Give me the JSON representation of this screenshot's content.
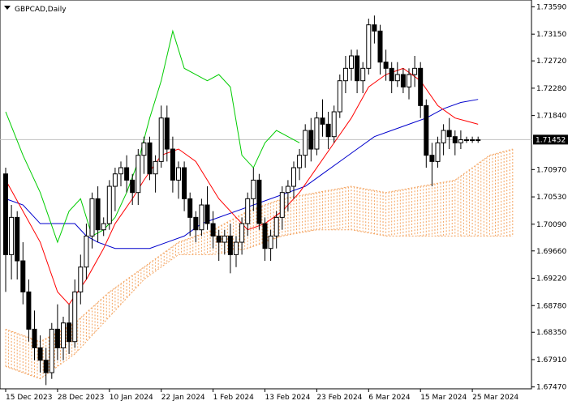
{
  "chart_data": {
    "type": "candlestick",
    "title": "GBPCAD,Daily",
    "y_range": [
      1.6744,
      1.737
    ],
    "y_ticks": [
      "1.73590",
      "1.73150",
      "1.72720",
      "1.72280",
      "1.71840",
      "1.71452",
      "1.70970",
      "1.70530",
      "1.70090",
      "1.69660",
      "1.69220",
      "1.68780",
      "1.68350",
      "1.67910",
      "1.67470"
    ],
    "x_labels": [
      {
        "label": "15 Dec 2023",
        "index": 0
      },
      {
        "label": "28 Dec 2023",
        "index": 9
      },
      {
        "label": "10 Jan 2024",
        "index": 18
      },
      {
        "label": "22 Jan 2024",
        "index": 27
      },
      {
        "label": "1 Feb 2024",
        "index": 36
      },
      {
        "label": "13 Feb 2024",
        "index": 45
      },
      {
        "label": "23 Feb 2024",
        "index": 54
      },
      {
        "label": "6 Mar 2024",
        "index": 63
      },
      {
        "label": "15 Mar 2024",
        "index": 72
      },
      {
        "label": "25 Mar 2024",
        "index": 81
      }
    ],
    "current_price": 1.71452,
    "colors": {
      "tenkan": "#ff0000",
      "kijun": "#0000cc",
      "chikou": "#00cc00",
      "cloud": "#f4a460",
      "candle": "#000000",
      "bullish_body": "#ffffff",
      "bearish_body": "#000000",
      "price_tag_bg": "#000000",
      "current_line": "#c0c0c0"
    },
    "candles": [
      [
        1.709,
        1.71,
        1.69,
        1.696
      ],
      [
        1.696,
        1.704,
        1.692,
        1.702
      ],
      [
        1.702,
        1.703,
        1.692,
        1.695
      ],
      [
        1.695,
        1.698,
        1.688,
        1.69
      ],
      [
        1.69,
        1.692,
        1.682,
        1.684
      ],
      [
        1.684,
        1.687,
        1.679,
        1.681
      ],
      [
        1.681,
        1.683,
        1.677,
        1.679
      ],
      [
        1.679,
        1.681,
        1.675,
        1.677
      ],
      [
        1.677,
        1.685,
        1.676,
        1.684
      ],
      [
        1.684,
        1.688,
        1.679,
        1.681
      ],
      [
        1.681,
        1.686,
        1.679,
        1.685
      ],
      [
        1.685,
        1.688,
        1.68,
        1.682
      ],
      [
        1.682,
        1.692,
        1.681,
        1.69
      ],
      [
        1.69,
        1.696,
        1.688,
        1.694
      ],
      [
        1.694,
        1.701,
        1.692,
        1.699
      ],
      [
        1.699,
        1.706,
        1.697,
        1.705
      ],
      [
        1.705,
        1.707,
        1.698,
        1.7
      ],
      [
        1.7,
        1.702,
        1.699,
        1.701
      ],
      [
        1.701,
        1.708,
        1.7,
        1.707
      ],
      [
        1.707,
        1.71,
        1.703,
        1.709
      ],
      [
        1.709,
        1.711,
        1.707,
        1.71
      ],
      [
        1.71,
        1.712,
        1.706,
        1.708
      ],
      [
        1.708,
        1.709,
        1.704,
        1.706
      ],
      [
        1.706,
        1.713,
        1.704,
        1.712
      ],
      [
        1.712,
        1.715,
        1.709,
        1.714
      ],
      [
        1.714,
        1.715,
        1.708,
        1.709
      ],
      [
        1.709,
        1.712,
        1.706,
        1.711
      ],
      [
        1.711,
        1.72,
        1.71,
        1.718
      ],
      [
        1.718,
        1.72,
        1.711,
        1.713
      ],
      [
        1.713,
        1.715,
        1.706,
        1.708
      ],
      [
        1.708,
        1.711,
        1.705,
        1.71
      ],
      [
        1.71,
        1.711,
        1.703,
        1.705
      ],
      [
        1.705,
        1.706,
        1.699,
        1.702
      ],
      [
        1.702,
        1.703,
        1.698,
        1.7
      ],
      [
        1.7,
        1.705,
        1.699,
        1.704
      ],
      [
        1.704,
        1.707,
        1.7,
        1.701
      ],
      [
        1.701,
        1.703,
        1.697,
        1.699
      ],
      [
        1.699,
        1.7,
        1.695,
        1.698
      ],
      [
        1.698,
        1.7,
        1.696,
        1.699
      ],
      [
        1.699,
        1.701,
        1.693,
        1.696
      ],
      [
        1.696,
        1.699,
        1.694,
        1.698
      ],
      [
        1.698,
        1.702,
        1.696,
        1.701
      ],
      [
        1.701,
        1.706,
        1.699,
        1.705
      ],
      [
        1.705,
        1.71,
        1.703,
        1.708
      ],
      [
        1.708,
        1.709,
        1.7,
        1.701
      ],
      [
        1.701,
        1.702,
        1.695,
        1.697
      ],
      [
        1.697,
        1.7,
        1.695,
        1.699
      ],
      [
        1.699,
        1.703,
        1.697,
        1.702
      ],
      [
        1.702,
        1.707,
        1.7,
        1.706
      ],
      [
        1.706,
        1.708,
        1.703,
        1.707
      ],
      [
        1.707,
        1.711,
        1.705,
        1.71
      ],
      [
        1.71,
        1.713,
        1.708,
        1.712
      ],
      [
        1.712,
        1.717,
        1.71,
        1.716
      ],
      [
        1.716,
        1.718,
        1.711,
        1.713
      ],
      [
        1.713,
        1.719,
        1.712,
        1.718
      ],
      [
        1.718,
        1.721,
        1.715,
        1.717
      ],
      [
        1.717,
        1.719,
        1.713,
        1.715
      ],
      [
        1.715,
        1.72,
        1.714,
        1.719
      ],
      [
        1.719,
        1.725,
        1.718,
        1.724
      ],
      [
        1.724,
        1.728,
        1.722,
        1.726
      ],
      [
        1.726,
        1.729,
        1.724,
        1.728
      ],
      [
        1.728,
        1.729,
        1.722,
        1.724
      ],
      [
        1.724,
        1.727,
        1.722,
        1.726
      ],
      [
        1.726,
        1.734,
        1.725,
        1.733
      ],
      [
        1.733,
        1.7345,
        1.73,
        1.732
      ],
      [
        1.732,
        1.733,
        1.725,
        1.727
      ],
      [
        1.727,
        1.729,
        1.724,
        1.726
      ],
      [
        1.726,
        1.727,
        1.722,
        1.724
      ],
      [
        1.724,
        1.727,
        1.723,
        1.725
      ],
      [
        1.725,
        1.726,
        1.722,
        1.723
      ],
      [
        1.723,
        1.726,
        1.721,
        1.725
      ],
      [
        1.725,
        1.728,
        1.723,
        1.726
      ],
      [
        1.726,
        1.727,
        1.718,
        1.72
      ],
      [
        1.72,
        1.721,
        1.71,
        1.712
      ],
      [
        1.712,
        1.714,
        1.707,
        1.711
      ],
      [
        1.711,
        1.715,
        1.71,
        1.714
      ],
      [
        1.714,
        1.717,
        1.712,
        1.716
      ],
      [
        1.716,
        1.718,
        1.713,
        1.715
      ],
      [
        1.715,
        1.716,
        1.712,
        1.714
      ],
      [
        1.714,
        1.716,
        1.713,
        1.7145
      ],
      [
        1.7145,
        1.715,
        1.714,
        1.7145
      ],
      [
        1.7145,
        1.715,
        1.714,
        1.7145
      ],
      [
        1.7145,
        1.715,
        1.714,
        1.7145
      ]
    ],
    "tenkan": [
      [
        0,
        1.708
      ],
      [
        3,
        1.703
      ],
      [
        6,
        1.698
      ],
      [
        9,
        1.69
      ],
      [
        11,
        1.688
      ],
      [
        14,
        1.692
      ],
      [
        17,
        1.697
      ],
      [
        19,
        1.701
      ],
      [
        22,
        1.705
      ],
      [
        24,
        1.708
      ],
      [
        27,
        1.712
      ],
      [
        30,
        1.713
      ],
      [
        33,
        1.711
      ],
      [
        35,
        1.708
      ],
      [
        37,
        1.705
      ],
      [
        39,
        1.703
      ],
      [
        42,
        1.7
      ],
      [
        45,
        1.701
      ],
      [
        48,
        1.703
      ],
      [
        51,
        1.706
      ],
      [
        54,
        1.71
      ],
      [
        57,
        1.714
      ],
      [
        60,
        1.718
      ],
      [
        63,
        1.723
      ],
      [
        66,
        1.725
      ],
      [
        69,
        1.726
      ],
      [
        72,
        1.724
      ],
      [
        75,
        1.72
      ],
      [
        78,
        1.718
      ],
      [
        80,
        1.7175
      ],
      [
        82,
        1.717
      ]
    ],
    "kijun": [
      [
        0,
        1.705
      ],
      [
        3,
        1.704
      ],
      [
        6,
        1.701
      ],
      [
        9,
        1.701
      ],
      [
        12,
        1.701
      ],
      [
        14,
        1.699
      ],
      [
        16,
        1.698
      ],
      [
        19,
        1.697
      ],
      [
        22,
        1.697
      ],
      [
        25,
        1.697
      ],
      [
        28,
        1.698
      ],
      [
        31,
        1.699
      ],
      [
        34,
        1.701
      ],
      [
        37,
        1.702
      ],
      [
        40,
        1.703
      ],
      [
        43,
        1.704
      ],
      [
        46,
        1.705
      ],
      [
        49,
        1.706
      ],
      [
        52,
        1.707
      ],
      [
        55,
        1.709
      ],
      [
        58,
        1.711
      ],
      [
        61,
        1.713
      ],
      [
        64,
        1.715
      ],
      [
        67,
        1.716
      ],
      [
        70,
        1.717
      ],
      [
        73,
        1.718
      ],
      [
        76,
        1.7195
      ],
      [
        79,
        1.7205
      ],
      [
        82,
        1.721
      ]
    ],
    "chikou": [
      [
        0,
        1.719
      ],
      [
        3,
        1.712
      ],
      [
        6,
        1.706
      ],
      [
        9,
        1.698
      ],
      [
        11,
        1.703
      ],
      [
        13,
        1.705
      ],
      [
        15,
        1.699
      ],
      [
        17,
        1.7
      ],
      [
        19,
        1.702
      ],
      [
        21,
        1.706
      ],
      [
        23,
        1.711
      ],
      [
        25,
        1.718
      ],
      [
        27,
        1.724
      ],
      [
        29,
        1.732
      ],
      [
        31,
        1.726
      ],
      [
        33,
        1.725
      ],
      [
        35,
        1.724
      ],
      [
        37,
        1.725
      ],
      [
        39,
        1.723
      ],
      [
        41,
        1.712
      ],
      [
        43,
        1.71
      ],
      [
        45,
        1.714
      ],
      [
        47,
        1.716
      ],
      [
        49,
        1.715
      ],
      [
        51,
        1.714
      ]
    ],
    "cloud_a": [
      [
        0,
        1.684
      ],
      [
        6,
        1.682
      ],
      [
        12,
        1.685
      ],
      [
        18,
        1.69
      ],
      [
        24,
        1.694
      ],
      [
        30,
        1.698
      ],
      [
        36,
        1.7
      ],
      [
        42,
        1.703
      ],
      [
        48,
        1.705
      ],
      [
        54,
        1.706
      ],
      [
        60,
        1.707
      ],
      [
        66,
        1.706
      ],
      [
        72,
        1.707
      ],
      [
        78,
        1.708
      ],
      [
        84,
        1.712
      ],
      [
        88,
        1.713
      ]
    ],
    "cloud_b": [
      [
        0,
        1.678
      ],
      [
        6,
        1.676
      ],
      [
        12,
        1.68
      ],
      [
        18,
        1.686
      ],
      [
        24,
        1.692
      ],
      [
        30,
        1.696
      ],
      [
        36,
        1.696
      ],
      [
        42,
        1.697
      ],
      [
        48,
        1.699
      ],
      [
        54,
        1.7
      ],
      [
        60,
        1.7
      ],
      [
        66,
        1.699
      ],
      [
        72,
        1.699
      ],
      [
        78,
        1.699
      ],
      [
        84,
        1.699
      ],
      [
        88,
        1.699
      ]
    ]
  }
}
